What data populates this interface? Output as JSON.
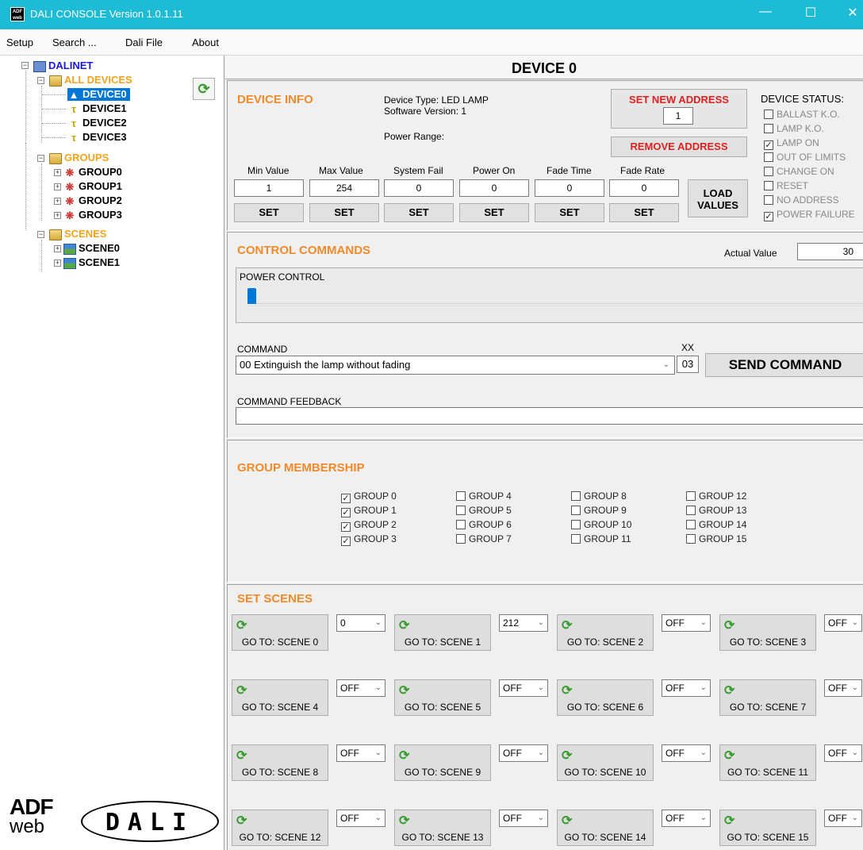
{
  "window": {
    "title": "DALI CONSOLE Version 1.0.1.11",
    "logo_text": "ADF web"
  },
  "menu": [
    "Setup",
    "Search ...",
    "Dali File",
    "About"
  ],
  "tree": {
    "root": "DALINET",
    "all_devices": "ALL DEVICES",
    "devices": [
      "DEVICE0",
      "DEVICE1",
      "DEVICE2",
      "DEVICE3"
    ],
    "groups_label": "GROUPS",
    "groups": [
      "GROUP0",
      "GROUP1",
      "GROUP2",
      "GROUP3"
    ],
    "scenes_label": "SCENES",
    "scenes": [
      "SCENE0",
      "SCENE1"
    ]
  },
  "brand": {
    "adf": "ADF",
    "web": "web",
    "dali": "DALI"
  },
  "device_header": "DEVICE 0",
  "device_info": {
    "title": "DEVICE INFO",
    "device_type": "Device Type:  LED LAMP",
    "software_version": "Software Version: 1",
    "power_range": "Power Range:",
    "set_new_address": "SET NEW ADDRESS",
    "address_value": "1",
    "remove_address": "REMOVE  ADDRESS",
    "fields": [
      {
        "label": "Min Value",
        "value": "1"
      },
      {
        "label": "Max Value",
        "value": "254"
      },
      {
        "label": "System Fail",
        "value": "0"
      },
      {
        "label": "Power On",
        "value": "0"
      },
      {
        "label": "Fade Time",
        "value": "0"
      },
      {
        "label": "Fade Rate",
        "value": "0"
      }
    ],
    "set_label": "SET",
    "load_values_1": "LOAD",
    "load_values_2": "VALUES"
  },
  "device_status": {
    "title": "DEVICE STATUS:",
    "items": [
      {
        "label": "BALLAST K.O.",
        "checked": false
      },
      {
        "label": "LAMP K.O.",
        "checked": false
      },
      {
        "label": "LAMP ON",
        "checked": true
      },
      {
        "label": "OUT OF LIMITS",
        "checked": false
      },
      {
        "label": "CHANGE ON",
        "checked": false
      },
      {
        "label": "RESET",
        "checked": false
      },
      {
        "label": "NO ADDRESS",
        "checked": false
      },
      {
        "label": "POWER FAILURE",
        "checked": true
      }
    ]
  },
  "control": {
    "title": "CONTROL COMMANDS",
    "actual_value_label": "Actual Value",
    "actual_value": "30",
    "power_control_label": "POWER CONTROL",
    "slider_level": 0.12,
    "command_label": "COMMAND",
    "command_value": "00 Extinguish the lamp without fading",
    "xx_label": "XX",
    "xx_value": "03",
    "send_command": "SEND COMMAND",
    "feedback_label": "COMMAND FEEDBACK",
    "feedback_value": ""
  },
  "groups_membership": {
    "title": "GROUP MEMBERSHIP",
    "items": [
      {
        "label": "GROUP 0",
        "checked": true
      },
      {
        "label": "GROUP 1",
        "checked": true
      },
      {
        "label": "GROUP 2",
        "checked": true
      },
      {
        "label": "GROUP 3",
        "checked": true
      },
      {
        "label": "GROUP 4",
        "checked": false
      },
      {
        "label": "GROUP 5",
        "checked": false
      },
      {
        "label": "GROUP 6",
        "checked": false
      },
      {
        "label": "GROUP 7",
        "checked": false
      },
      {
        "label": "GROUP 8",
        "checked": false
      },
      {
        "label": "GROUP 9",
        "checked": false
      },
      {
        "label": "GROUP 10",
        "checked": false
      },
      {
        "label": "GROUP 11",
        "checked": false
      },
      {
        "label": "GROUP 12",
        "checked": false
      },
      {
        "label": "GROUP 13",
        "checked": false
      },
      {
        "label": "GROUP 14",
        "checked": false
      },
      {
        "label": "GROUP 15",
        "checked": false
      }
    ]
  },
  "scenes": {
    "title": "SET SCENES",
    "items": [
      {
        "label": "GO TO: SCENE 0",
        "value": "0"
      },
      {
        "label": "GO TO: SCENE 1",
        "value": "212"
      },
      {
        "label": "GO TO: SCENE 2",
        "value": "OFF"
      },
      {
        "label": "GO TO: SCENE 3",
        "value": "OFF"
      },
      {
        "label": "GO TO: SCENE 4",
        "value": "OFF"
      },
      {
        "label": "GO TO: SCENE 5",
        "value": "OFF"
      },
      {
        "label": "GO TO: SCENE 6",
        "value": "OFF"
      },
      {
        "label": "GO TO: SCENE 7",
        "value": "OFF"
      },
      {
        "label": "GO TO: SCENE 8",
        "value": "OFF"
      },
      {
        "label": "GO TO: SCENE 9",
        "value": "OFF"
      },
      {
        "label": "GO TO: SCENE 10",
        "value": "OFF"
      },
      {
        "label": "GO TO: SCENE 11",
        "value": "OFF"
      },
      {
        "label": "GO TO: SCENE 12",
        "value": "OFF"
      },
      {
        "label": "GO TO: SCENE 13",
        "value": "OFF"
      },
      {
        "label": "GO TO: SCENE 14",
        "value": "OFF"
      },
      {
        "label": "GO TO: SCENE 15",
        "value": "OFF"
      }
    ]
  },
  "colors": {
    "titlebar": "#1ebbd6",
    "section_title": "#f08a2a",
    "alert_red": "#e02020",
    "tree_blue": "#1a1adc",
    "tree_orange": "#f2a31b",
    "selected": "#0078d7"
  }
}
